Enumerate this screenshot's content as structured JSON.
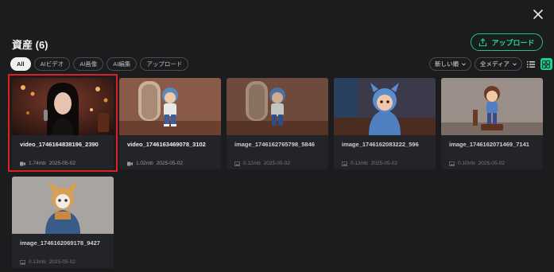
{
  "header": {
    "title": "資産 (6)",
    "upload_label": "アップロード"
  },
  "filters": [
    {
      "label": "All",
      "active": true
    },
    {
      "label": "AIビデオ",
      "active": false
    },
    {
      "label": "AI画像",
      "active": false
    },
    {
      "label": "AI編集",
      "active": false
    },
    {
      "label": "アップロード",
      "active": false
    }
  ],
  "controls": {
    "sort_label": "新しい順",
    "media_label": "全メディア"
  },
  "assets": [
    {
      "name": "video_1746164838196_2390",
      "kind": "video",
      "size": "1.74mb",
      "date": "2025-05-02",
      "highlighted": true
    },
    {
      "name": "video_1746163469078_3102",
      "kind": "video",
      "size": "1.02mb",
      "date": "2025-05-02"
    },
    {
      "name": "image_1746162765798_5846",
      "kind": "image",
      "size": "0.12mb",
      "date": "2025-05-02"
    },
    {
      "name": "image_1746162083222_596",
      "kind": "image",
      "size": "0.13mb",
      "date": "2025-05-02"
    },
    {
      "name": "image_1746162071469_7141",
      "kind": "image",
      "size": "0.10mb",
      "date": "2025-05-02"
    },
    {
      "name": "image_1746162069178_9427",
      "kind": "image",
      "size": "0.13mb",
      "date": "2025-05-02"
    }
  ],
  "colors": {
    "accent": "#22c08a",
    "highlight": "#e02020",
    "background": "#1b1c1e"
  }
}
